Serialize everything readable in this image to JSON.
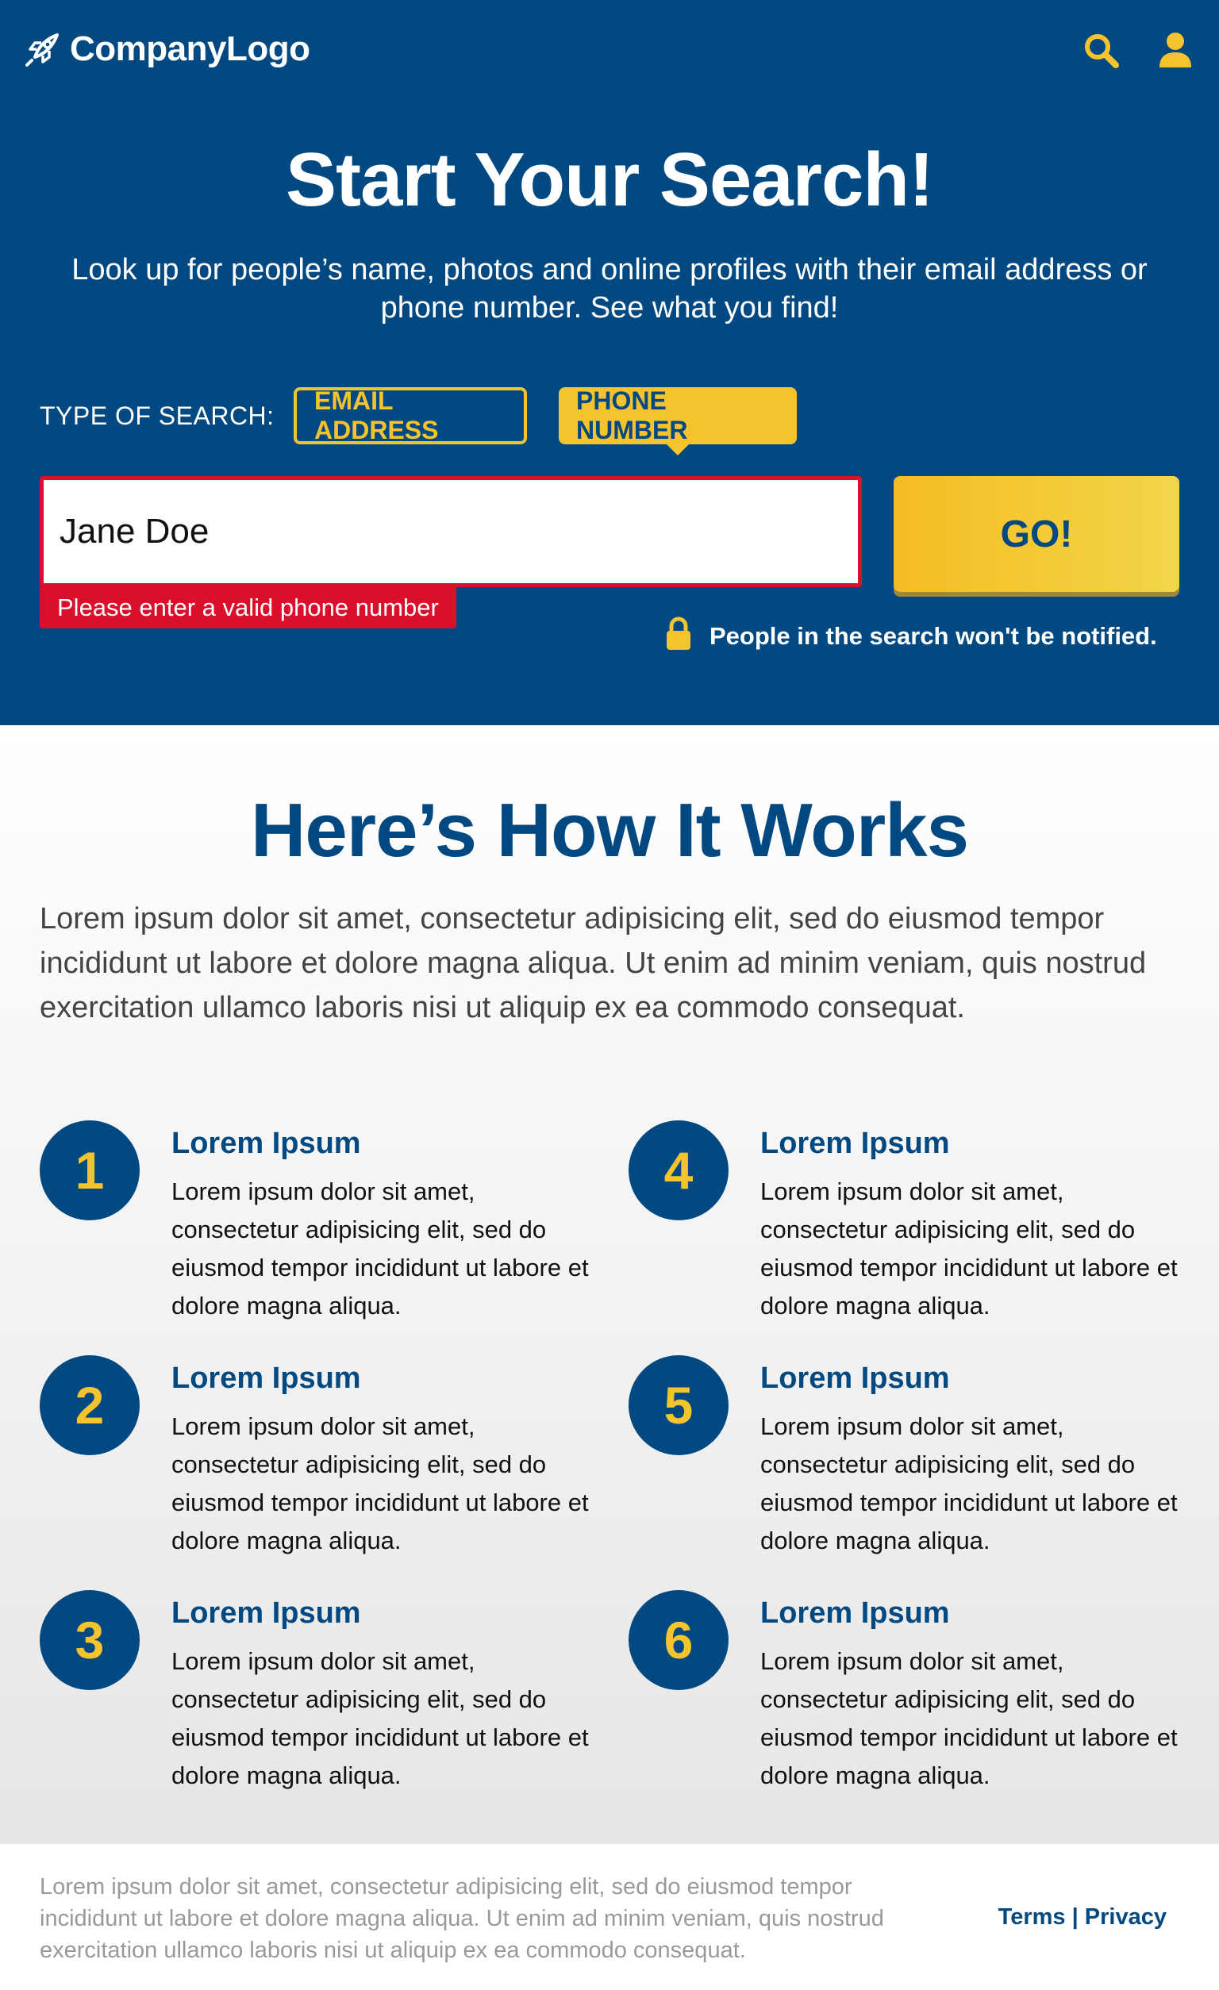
{
  "brand": {
    "logo_text": "CompanyLogo",
    "primary_color": "#024981",
    "accent_color": "#f5c32d",
    "error_color": "#d8102b"
  },
  "header": {
    "icons": [
      "search-icon",
      "user-icon"
    ]
  },
  "hero": {
    "title": "Start Your Search!",
    "subtitle": "Look up for people’s name, photos and online profiles with their email address or phone number. See what you find!",
    "search_type_label": "TYPE OF SEARCH:",
    "search_types": [
      {
        "label": "EMAIL ADDRESS",
        "selected": false
      },
      {
        "label": "PHONE NUMBER",
        "selected": true
      }
    ],
    "input_value": "Jane Doe",
    "error_message": "Please enter a valid phone number",
    "go_label": "GO!",
    "privacy_note": "People in the search won't be notified."
  },
  "how": {
    "title": "Here’s How It Works",
    "description": "Lorem ipsum dolor sit amet, consectetur adipisicing elit, sed do eiusmod tempor incididunt ut labore et dolore magna aliqua. Ut enim ad minim veniam, quis nostrud exercitation ullamco laboris nisi ut aliquip ex ea commodo consequat.",
    "steps": [
      {
        "number": "1",
        "title": "Lorem Ipsum",
        "text": "Lorem ipsum dolor sit amet, consectetur adipisicing elit, sed do eiusmod tempor incididunt ut labore et dolore magna aliqua."
      },
      {
        "number": "2",
        "title": "Lorem Ipsum",
        "text": "Lorem ipsum dolor sit amet, consectetur adipisicing elit, sed do eiusmod tempor incididunt ut labore et dolore magna aliqua."
      },
      {
        "number": "3",
        "title": "Lorem Ipsum",
        "text": "Lorem ipsum dolor sit amet, consectetur adipisicing elit, sed do eiusmod tempor incididunt ut labore et dolore magna aliqua."
      },
      {
        "number": "4",
        "title": "Lorem Ipsum",
        "text": "Lorem ipsum dolor sit amet, consectetur adipisicing elit, sed do eiusmod tempor incididunt ut labore et dolore magna aliqua."
      },
      {
        "number": "5",
        "title": "Lorem Ipsum",
        "text": "Lorem ipsum dolor sit amet, consectetur adipisicing elit, sed do eiusmod tempor incididunt ut labore et dolore magna aliqua."
      },
      {
        "number": "6",
        "title": "Lorem Ipsum",
        "text": "Lorem ipsum dolor sit amet, consectetur adipisicing elit, sed do eiusmod tempor incididunt ut labore et dolore magna aliqua."
      }
    ]
  },
  "footer": {
    "text": "Lorem ipsum dolor sit amet, consectetur adipisicing elit, sed do eiusmod tempor incididunt ut labore et dolore magna aliqua. Ut enim ad minim veniam, quis nostrud exercitation ullamco laboris nisi ut aliquip ex ea commodo consequat.",
    "terms_label": "Terms",
    "separator": " | ",
    "privacy_label": "Privacy"
  }
}
